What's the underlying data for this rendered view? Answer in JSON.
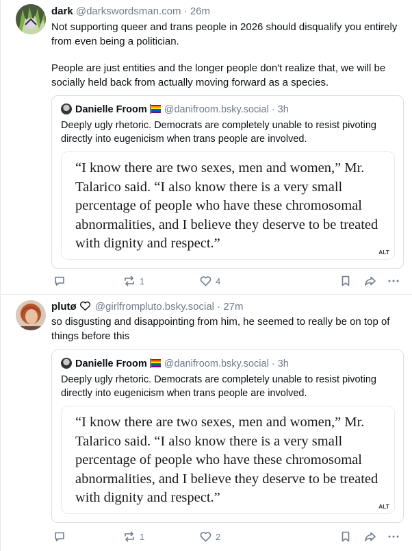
{
  "posts": [
    {
      "author": {
        "name": "dark",
        "handle": "@darkswordsman.com",
        "time": "26m"
      },
      "text_lines": [
        "Not supporting queer and trans people in 2026 should disqualify you entirely from even being a politician.",
        "People are just entities and the longer people don't realize that, we will be socially held back from actually moving forward as a species."
      ],
      "quote": {
        "author": {
          "name": "Danielle Froom",
          "handle": "@danifroom.bsky.social",
          "time": "3h"
        },
        "text": "Deeply ugly rhetoric. Democrats are completely unable to resist pivoting directly into eugenicism when trans people are involved.",
        "image_text": "“I know there are two sexes, men and women,” Mr. Talarico said. “I also know there is a very small percentage of people who have these chromosomal abnormalities, and I believe they deserve to be treated with dignity and respect.”",
        "alt_badge": "ALT"
      },
      "actions": {
        "repost_count": "1",
        "like_count": "4"
      }
    },
    {
      "author": {
        "name": "plutø",
        "handle": "@girlfrompluto.bsky.social",
        "time": "27m"
      },
      "text_lines": [
        "so disgusting and disappointing from him, he seemed to really be on top of things before this"
      ],
      "quote": {
        "author": {
          "name": "Danielle Froom",
          "handle": "@danifroom.bsky.social",
          "time": "3h"
        },
        "text": "Deeply ugly rhetoric. Democrats are completely unable to resist pivoting directly into eugenicism when trans people are involved.",
        "image_text": "“I know there are two sexes, men and women,” Mr. Talarico said. “I also know there is a very small percentage of people who have these chromosomal abnormalities, and I believe they deserve to be treated with dignity and respect.”",
        "alt_badge": "ALT"
      },
      "actions": {
        "repost_count": "1",
        "like_count": "2"
      }
    }
  ],
  "separator": " · ",
  "colors": {
    "text": "#0b0f14",
    "muted": "#6f7c8a",
    "border": "#e3e7ec"
  },
  "icons": [
    "reply-icon",
    "repost-icon",
    "like-icon",
    "bookmark-icon",
    "share-icon",
    "more-icon",
    "heart-outline-icon",
    "pride-flag-icon"
  ]
}
